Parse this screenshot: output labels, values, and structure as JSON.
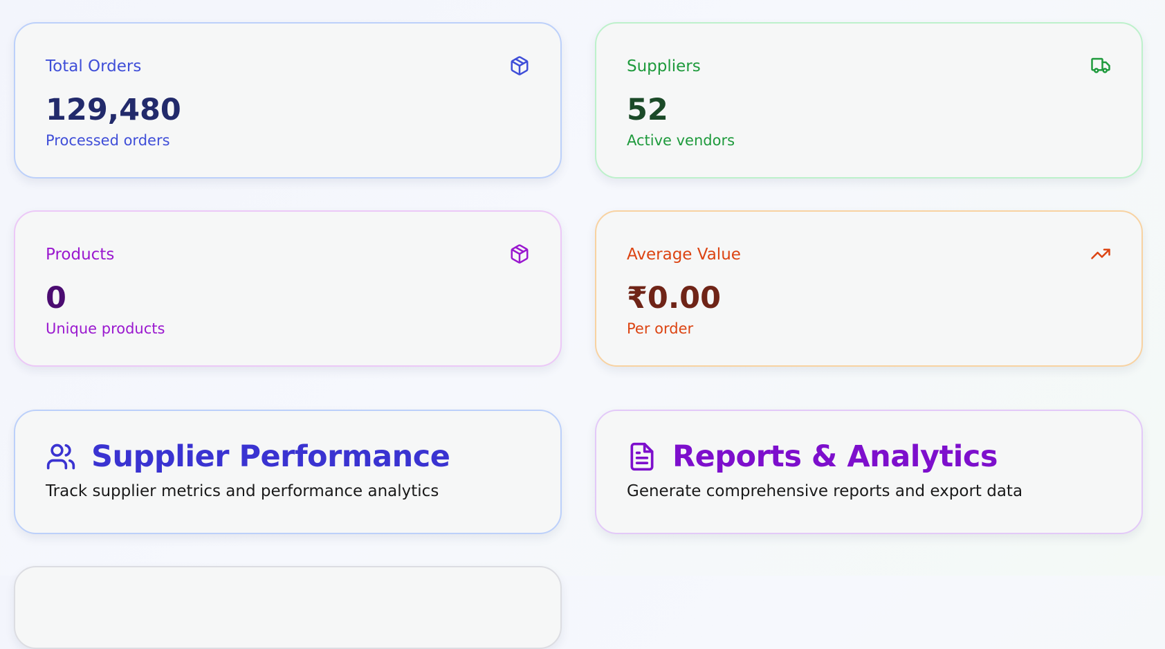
{
  "stats": {
    "orders": {
      "label": "Total Orders",
      "value": "129,480",
      "sub": "Processed orders",
      "icon": "box-icon",
      "label_color": "#3f4ed8",
      "value_color": "#222a6b"
    },
    "suppliers": {
      "label": "Suppliers",
      "value": "52",
      "sub": "Active vendors",
      "icon": "truck-icon",
      "label_color": "#1e9a3c",
      "value_color": "#1b4a28"
    },
    "products": {
      "label": "Products",
      "value": "0",
      "sub": "Unique products",
      "icon": "box-icon",
      "label_color": "#9a18cf",
      "value_color": "#4b0c71"
    },
    "average": {
      "label": "Average Value",
      "value": "₹0.00",
      "sub": "Per order",
      "icon": "trending-up-icon",
      "label_color": "#dc4412",
      "value_color": "#6f2417"
    }
  },
  "features": {
    "supplier_performance": {
      "title": "Supplier Performance",
      "description": "Track supplier metrics and performance analytics",
      "icon": "users-icon",
      "color": "#3a33d1"
    },
    "reports": {
      "title": "Reports & Analytics",
      "description": "Generate comprehensive reports and export data",
      "icon": "document-icon",
      "color": "#7d0fcc"
    }
  }
}
